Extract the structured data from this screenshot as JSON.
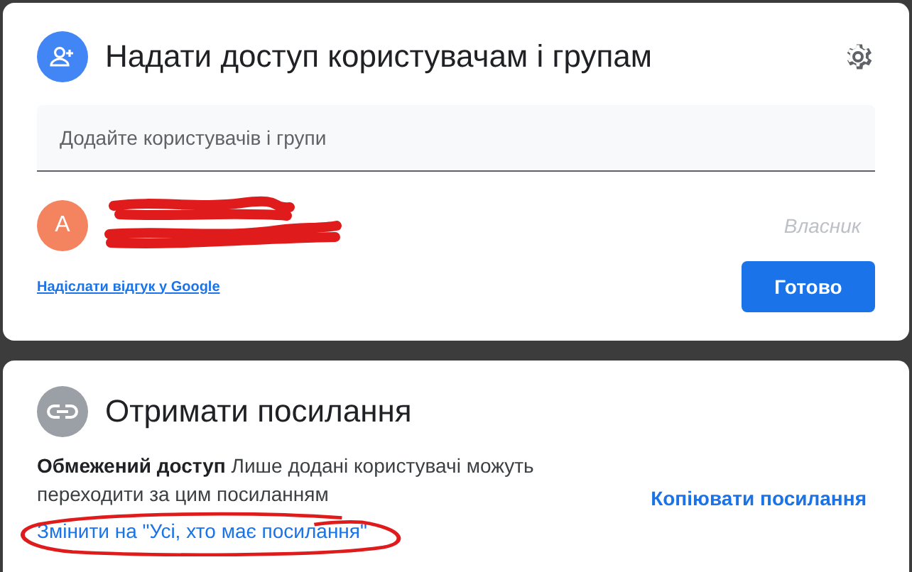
{
  "share": {
    "title": "Надати доступ користувачам і групам",
    "add_field": {
      "placeholder": "Додайте користувачів і групи"
    },
    "people": [
      {
        "avatar": "A",
        "role": "Власник",
        "redacted": true
      }
    ],
    "feedback_link": "Надіслати відгук у Google",
    "done_button": "Готово"
  },
  "link": {
    "title": "Отримати посилання",
    "description": "**Обмежений доступ** Лише додані користувачі можуть переходити за цим посиланням",
    "change_link": "Змінити на \"Усі, хто має посилання\"",
    "highlighted": true,
    "copy_link": "Копіювати посилання"
  }
}
